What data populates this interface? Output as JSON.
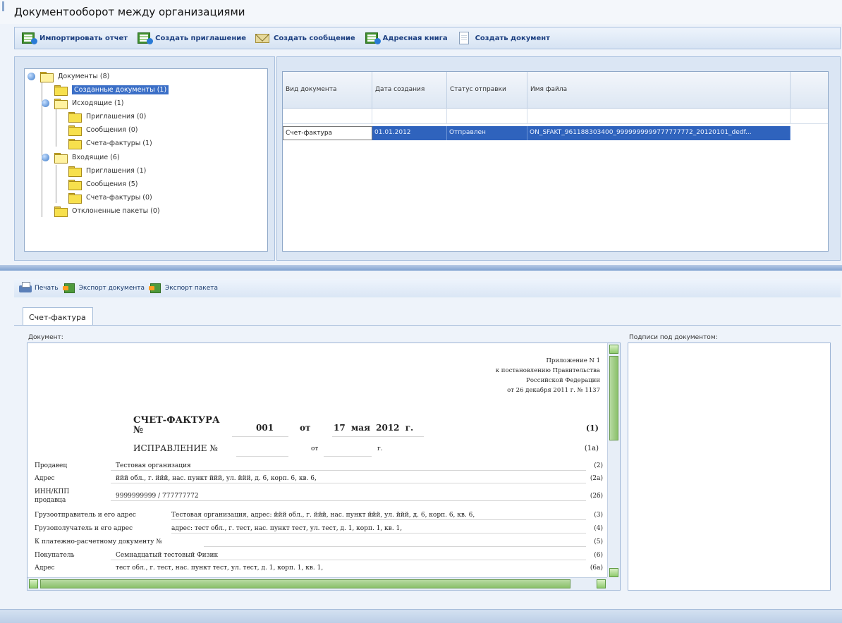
{
  "app": {
    "title": "Документооборот между организациями"
  },
  "toolbar": {
    "items": [
      {
        "label": "Импортировать отчет",
        "icon": "import-report-icon"
      },
      {
        "label": "Создать приглашение",
        "icon": "create-invitation-icon"
      },
      {
        "label": "Создать сообщение",
        "icon": "create-message-icon"
      },
      {
        "label": "Адресная книга",
        "icon": "address-book-icon"
      },
      {
        "label": "Создать документ",
        "icon": "create-document-icon"
      }
    ]
  },
  "tree": {
    "nodes": [
      {
        "label": "Документы (8)"
      },
      {
        "label": "Созданные документы (1)",
        "selected": true
      },
      {
        "label": "Исходящие (1)"
      },
      {
        "label": "Приглашения (0)"
      },
      {
        "label": "Сообщения (0)"
      },
      {
        "label": "Счета-фактуры (1)"
      },
      {
        "label": "Входящие (6)"
      },
      {
        "label": "Приглашения (1)"
      },
      {
        "label": "Сообщения (5)"
      },
      {
        "label": "Счета-фактуры (0)"
      },
      {
        "label": "Отклоненные пакеты (0)"
      }
    ]
  },
  "grid": {
    "columns": [
      "Вид документа",
      "Дата создания",
      "Статус отправки",
      "Имя файла"
    ],
    "rows": [
      [
        "Счет-фактура",
        "01.01.2012",
        "Отправлен",
        "ON_SFAKT_961188303400_9999999999777777772_20120101_dedf..."
      ]
    ]
  },
  "toolbar2": {
    "items": [
      {
        "label": "Печать",
        "icon": "printer-icon"
      },
      {
        "label": "Экспорт документа",
        "icon": "export-document-icon"
      },
      {
        "label": "Экспорт пакета",
        "icon": "export-package-icon"
      }
    ]
  },
  "tabs": [
    {
      "label": "Счет-фактура",
      "active": true
    }
  ],
  "document_panel": {
    "label": "Документ:"
  },
  "signatures_panel": {
    "label": "Подписи под документом:"
  },
  "document": {
    "annex": [
      "Приложение N 1",
      "к постановлению Правительства",
      "Российской Федерации",
      "от 26 декабря 2011 г. № 1137"
    ],
    "title": "СЧЕТ-ФАКТУРА №",
    "number": "001",
    "ot": "от",
    "date": "17 мая 2012 г.",
    "code": "(1)",
    "correction": {
      "label": "ИСПРАВЛЕНИЕ №",
      "ot": "от",
      "g": "г.",
      "code": "(1а)"
    },
    "rows": [
      {
        "key": "Продавец",
        "value": "Тестовая организация",
        "code": "(2)"
      },
      {
        "key": "Адрес",
        "value": "ййй обл., г. ййй, нас. пункт ййй, ул. ййй, д. 6, корп. 6, кв. 6,",
        "code": "(2а)"
      },
      {
        "key": "ИНН/КПП продавца",
        "value": "9999999999 / 777777772",
        "code": "(2б)"
      },
      {
        "key": "Грузоотправитель и его адрес",
        "value": "Тестовая организация, адрес: ййй обл., г. ййй, нас. пункт ййй, ул. ййй, д. 6, корп. 6, кв. 6,",
        "code": "(3)"
      },
      {
        "key": "Грузополучатель и его адрес",
        "value": "адрес: тест обл., г. тест, нас. пункт тест, ул. тест, д. 1, корп. 1, кв. 1,",
        "code": "(4)"
      },
      {
        "key": "К платежно-расчетному документу №",
        "value": "",
        "code": "(5)"
      },
      {
        "key": "Покупатель",
        "value": "Семнадцатый тестовый Физик",
        "code": "(6)"
      },
      {
        "key": "Адрес",
        "value": "тест обл., г. тест, нас. пункт тест, ул. тест, д. 1, корп. 1, кв. 1,",
        "code": "(6а)"
      }
    ]
  }
}
